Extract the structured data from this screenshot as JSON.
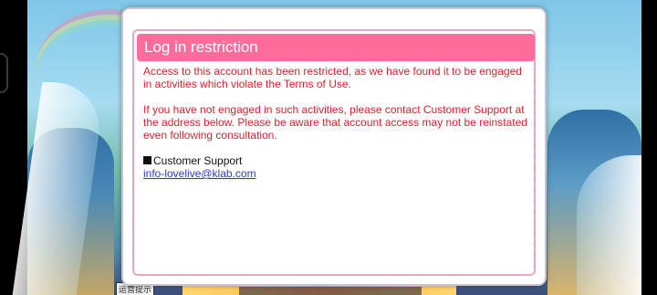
{
  "dialog": {
    "title": "Log in restriction",
    "paragraph_1": "Access to this account has been restricted, as we have found it to be engaged in activities which violate the Terms of Use.",
    "paragraph_2": "If you have not engaged in such activities, please contact Customer Support at the address below. Please be aware that account access may not be reinstated even following consultation.",
    "support_heading": "Customer Support",
    "support_email": "info-lovelive@klab.com"
  },
  "background": {
    "notice_tag": "运营提示"
  },
  "colors": {
    "title_bar": "#ff6b9a",
    "body_text": "#e0202a",
    "link": "#2a3ac8",
    "dialog_border": "#e9a7c6"
  }
}
